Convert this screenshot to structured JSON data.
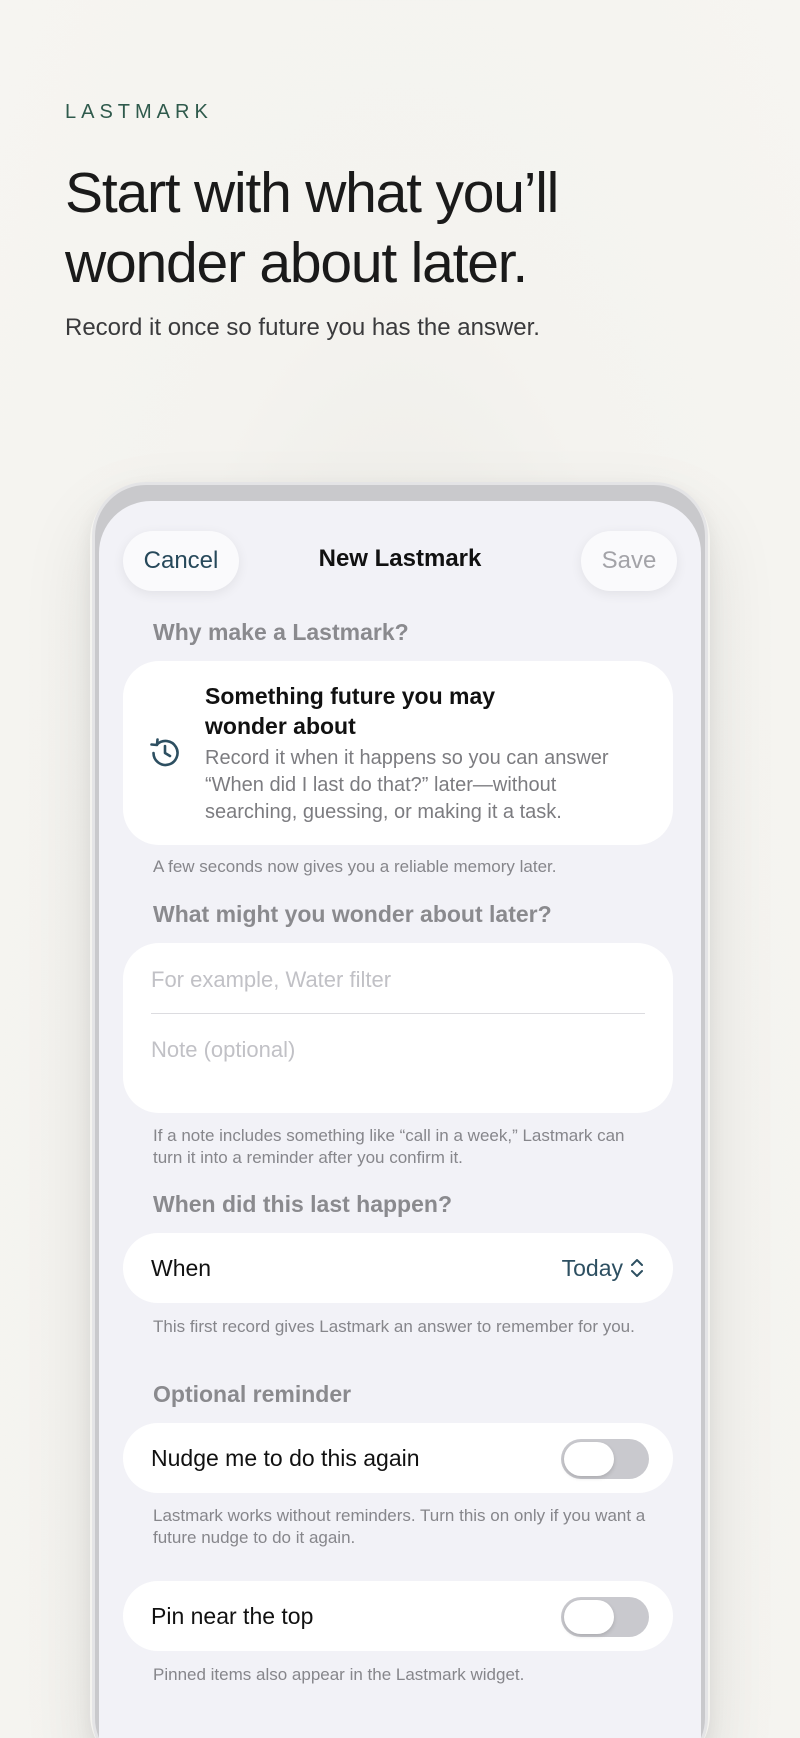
{
  "hero": {
    "brand": "LASTMARK",
    "headline": "Start with what you’ll wonder about later.",
    "subhead": "Record it once so future you has the answer."
  },
  "nav": {
    "cancel_label": "Cancel",
    "title": "New Lastmark",
    "save_label": "Save"
  },
  "why": {
    "heading": "Why make a Lastmark?",
    "card_title": "Something future you may wonder about",
    "card_body": "Record it when it happens so you can answer “When did I last do that?” later—without searching, guessing, or making it a task.",
    "icon": "clock-history-icon",
    "footnote": "A few seconds now gives you a reliable memory later."
  },
  "wonder": {
    "heading": "What might you wonder about later?",
    "name_placeholder": "For example, Water filter",
    "note_placeholder": "Note (optional)",
    "footnote": "If a note includes something like “call in a week,” Lastmark can turn it into a reminder after you confirm it."
  },
  "when": {
    "heading": "When did this last happen?",
    "label": "When",
    "value": "Today",
    "icon": "chevron-up-down-icon",
    "footnote": "This first record gives Lastmark an answer to remember for you."
  },
  "reminder": {
    "heading": "Optional reminder",
    "label": "Nudge me to do this again",
    "enabled": false,
    "footnote": "Lastmark works without reminders. Turn this on only if you want a future nudge to do it again."
  },
  "pin": {
    "label": "Pin near the top",
    "enabled": false,
    "footnote": "Pinned items also appear in the Lastmark widget."
  },
  "colors": {
    "brand": "#2f5a4c",
    "accent": "#26485a",
    "background": "#f2f2f7"
  }
}
